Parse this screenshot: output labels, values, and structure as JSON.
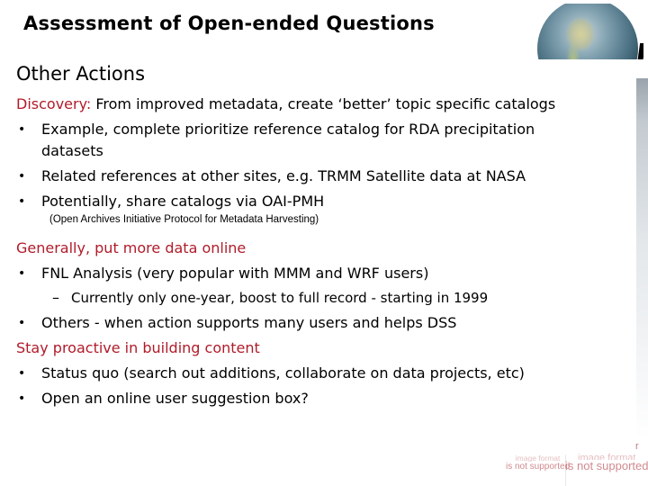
{
  "slide": {
    "title": "Assessment of Open-ended Questions",
    "section_title": "Other Actions",
    "globe_icon": "globe-icon",
    "accent_color": "#b01c2a",
    "discovery": {
      "label": "Discovery:",
      "text": " From improved metadata, create ‘better’ topic specific catalogs",
      "bullets": [
        {
          "line1": "Example, complete prioritize reference catalog for RDA precipitation",
          "line2": "datasets"
        },
        {
          "line1": "Related references at other sites, e.g. TRMM Satellite data at NASA"
        },
        {
          "line1": "Potentially, share catalogs via OAI-PMH"
        }
      ],
      "note": "(Open Archives Initiative Protocol for Metadata Harvesting)"
    },
    "online": {
      "heading": "Generally, put more data online",
      "bullets": [
        {
          "text": "FNL Analysis (very popular with MMM and WRF users)"
        },
        {
          "text": "Others - when action supports many users and helps DSS"
        }
      ],
      "sub_bullets": [
        {
          "dash": "–",
          "text": "Currently only one-year, boost to full record - starting in 1999"
        }
      ]
    },
    "proactive": {
      "heading": "Stay proactive in building content",
      "bullets": [
        {
          "text": "Status quo (search out additions, collaborate on data projects, etc)"
        },
        {
          "text": "Open an online user suggestion box?"
        }
      ]
    },
    "bullet_glyph": "•",
    "image_placeholders": [
      {
        "line1": "image format",
        "line2": "is not supported"
      },
      {
        "line1": "image format",
        "line2": "is not supported"
      }
    ],
    "placeholder_fragment": "r"
  }
}
